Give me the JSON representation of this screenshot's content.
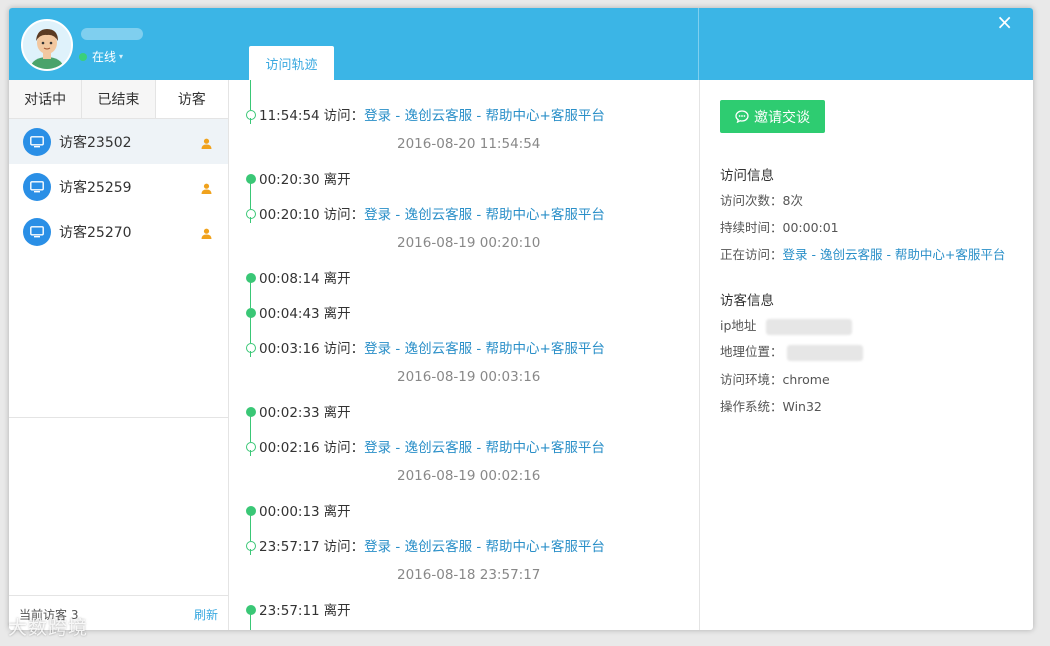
{
  "header": {
    "status": "在线",
    "close_label": "×",
    "tab_label": "访问轨迹"
  },
  "left_tabs": [
    "对话中",
    "已结束",
    "访客"
  ],
  "visitors": [
    {
      "name": "访客23502"
    },
    {
      "name": "访客25259"
    },
    {
      "name": "访客25270"
    }
  ],
  "left_footer": {
    "count_label": "当前访客 3",
    "refresh_label": "刷新"
  },
  "timeline": [
    {
      "type": "visit",
      "time": "11:54:54",
      "action": "访问：",
      "link": "登录 - 逸创云客服 - 帮助中心+客服平台",
      "date": "2016-08-20 11:54:54"
    },
    {
      "type": "leave",
      "time": "00:20:30",
      "action": "离开"
    },
    {
      "type": "visit",
      "time": "00:20:10",
      "action": "访问：",
      "link": "登录 - 逸创云客服 - 帮助中心+客服平台",
      "date": "2016-08-19 00:20:10"
    },
    {
      "type": "leave",
      "time": "00:08:14",
      "action": "离开"
    },
    {
      "type": "leave",
      "time": "00:04:43",
      "action": "离开"
    },
    {
      "type": "visit",
      "time": "00:03:16",
      "action": "访问：",
      "link": "登录 - 逸创云客服 - 帮助中心+客服平台",
      "date": "2016-08-19 00:03:16"
    },
    {
      "type": "leave",
      "time": "00:02:33",
      "action": "离开"
    },
    {
      "type": "visit",
      "time": "00:02:16",
      "action": "访问：",
      "link": "登录 - 逸创云客服 - 帮助中心+客服平台",
      "date": "2016-08-19 00:02:16"
    },
    {
      "type": "leave",
      "time": "00:00:13",
      "action": "离开"
    },
    {
      "type": "visit",
      "time": "23:57:17",
      "action": "访问：",
      "link": "登录 - 逸创云客服 - 帮助中心+客服平台",
      "date": "2016-08-18 23:57:17"
    },
    {
      "type": "leave",
      "time": "23:57:11",
      "action": "离开"
    }
  ],
  "right": {
    "invite_label": "邀请交谈",
    "visit_info_title": "访问信息",
    "visit_count": "访问次数：8次",
    "duration": "持续时间：00:00:01",
    "visiting_label": "正在访问：",
    "visiting_link": "登录 - 逸创云客服 - 帮助中心+客服平台",
    "visitor_info_title": "访客信息",
    "ip_label": "ip地址",
    "location_label": "地理位置：",
    "env": "访问环境：chrome",
    "os": "操作系统：Win32"
  },
  "watermark": "大数跨境",
  "colors": {
    "header": "#3bb5e6",
    "accent_green": "#2ecc71",
    "link": "#2a8fc8",
    "visitor_icon": "#2a8fe6",
    "person_icon": "#f0a21d"
  }
}
